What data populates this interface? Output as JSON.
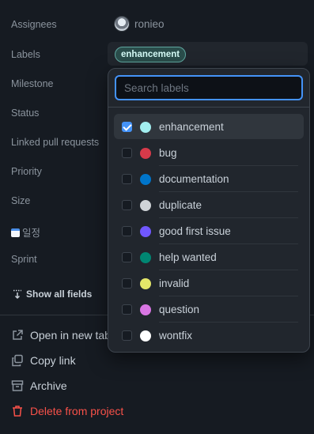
{
  "fields": {
    "assignees": "Assignees",
    "labels": "Labels",
    "milestone": "Milestone",
    "status": "Status",
    "linked_pull_requests": "Linked pull requests",
    "priority": "Priority",
    "size": "Size",
    "schedule": "일정",
    "sprint": "Sprint"
  },
  "assignee": {
    "name": "ronieo"
  },
  "labels_value": {
    "chip": "enhancement",
    "chip_color": "#a2eeef"
  },
  "show_all_fields": "Show all fields",
  "actions": {
    "open_in_new_tab": "Open in new tab",
    "copy_link": "Copy link",
    "archive": "Archive",
    "delete_from_project": "Delete from project"
  },
  "dropdown": {
    "search_placeholder": "Search labels",
    "options": [
      {
        "label": "enhancement",
        "color": "#a2eeef",
        "checked": true
      },
      {
        "label": "bug",
        "color": "#d73a4a",
        "checked": false
      },
      {
        "label": "documentation",
        "color": "#0075ca",
        "checked": false
      },
      {
        "label": "duplicate",
        "color": "#cfd3d7",
        "checked": false
      },
      {
        "label": "good first issue",
        "color": "#7057ff",
        "checked": false
      },
      {
        "label": "help wanted",
        "color": "#008672",
        "checked": false
      },
      {
        "label": "invalid",
        "color": "#e4e669",
        "checked": false
      },
      {
        "label": "question",
        "color": "#d876e3",
        "checked": false
      },
      {
        "label": "wontfix",
        "color": "#ffffff",
        "checked": false
      }
    ]
  },
  "colors": {
    "accent": "#4493f8",
    "danger": "#f85149",
    "background": "#161b22"
  }
}
